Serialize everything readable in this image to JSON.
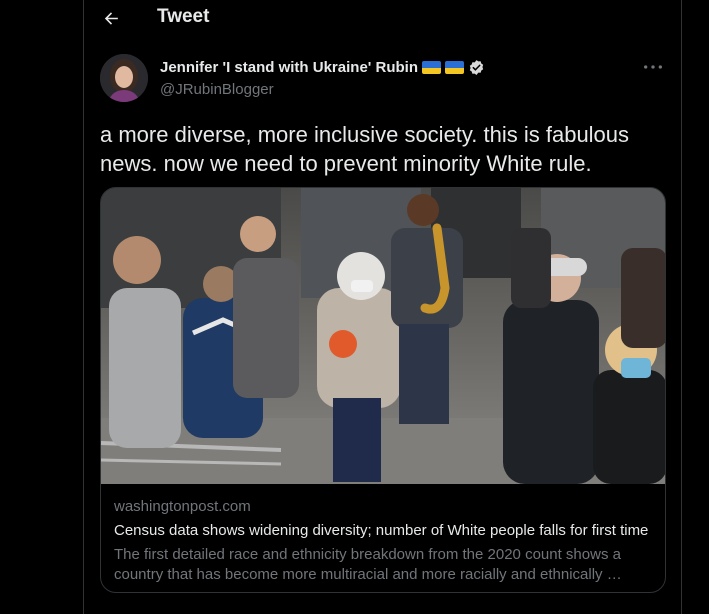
{
  "header": {
    "title": "Tweet",
    "back_icon": "arrow-left-icon"
  },
  "author": {
    "display_name": "Jennifer 'I stand with Ukraine' Rubin",
    "handle": "@JRubinBlogger",
    "flags": [
      "ukraine-flag-icon",
      "ukraine-flag-icon"
    ],
    "verified_icon": "verified-badge-icon",
    "more_icon": "more-options-icon"
  },
  "tweet": {
    "text": "a more diverse, more inclusive society. this is fabulous news. now we need to prevent minority White rule."
  },
  "card": {
    "image_description_icon": "article-photo",
    "domain": "washingtonpost.com",
    "title": "Census data shows widening diversity; number of White people falls for first time",
    "description": "The first detailed race and ethnicity breakdown from the 2020 count shows a country that has become more multiracial and more racially and ethnically …"
  },
  "colors": {
    "background": "#000000",
    "text_primary": "#e7e9ea",
    "text_secondary": "#71767b",
    "border": "#2f3336",
    "flag_blue": "#2b6fd6",
    "flag_yellow": "#f3c623"
  }
}
